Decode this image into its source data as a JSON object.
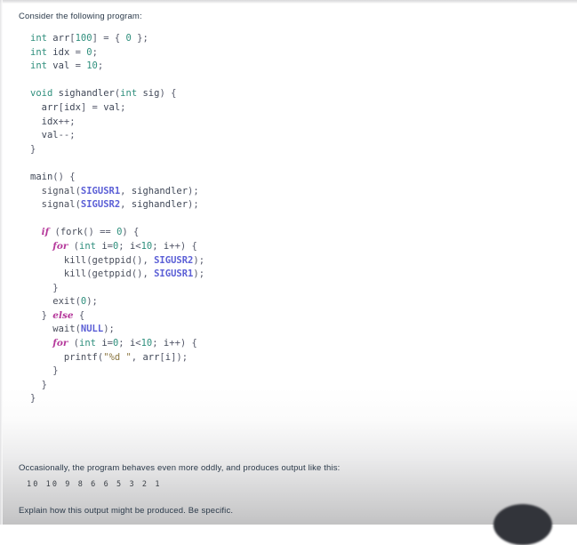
{
  "page": {
    "background_top": "#ffffff",
    "background_bottom": "#c2c2c3"
  },
  "intro": {
    "text": "Consider the following program:"
  },
  "code": {
    "language": "c",
    "lines": [
      [
        {
          "t": "int",
          "c": "tok-type"
        },
        {
          "t": " ",
          "c": "tok-plain"
        },
        {
          "t": "arr",
          "c": "tok-ident"
        },
        {
          "t": "[",
          "c": "tok-punc"
        },
        {
          "t": "100",
          "c": "tok-num"
        },
        {
          "t": "]",
          "c": "tok-punc"
        },
        {
          "t": " = { ",
          "c": "tok-punc"
        },
        {
          "t": "0",
          "c": "tok-num"
        },
        {
          "t": " };",
          "c": "tok-punc"
        }
      ],
      [
        {
          "t": "int",
          "c": "tok-type"
        },
        {
          "t": " ",
          "c": "tok-plain"
        },
        {
          "t": "idx",
          "c": "tok-ident"
        },
        {
          "t": " = ",
          "c": "tok-punc"
        },
        {
          "t": "0",
          "c": "tok-num"
        },
        {
          "t": ";",
          "c": "tok-punc"
        }
      ],
      [
        {
          "t": "int",
          "c": "tok-type"
        },
        {
          "t": " ",
          "c": "tok-plain"
        },
        {
          "t": "val",
          "c": "tok-ident"
        },
        {
          "t": " = ",
          "c": "tok-punc"
        },
        {
          "t": "10",
          "c": "tok-num"
        },
        {
          "t": ";",
          "c": "tok-punc"
        }
      ],
      [],
      [
        {
          "t": "void",
          "c": "tok-type"
        },
        {
          "t": " ",
          "c": "tok-plain"
        },
        {
          "t": "sighandler",
          "c": "tok-ident"
        },
        {
          "t": "(",
          "c": "tok-punc"
        },
        {
          "t": "int",
          "c": "tok-type"
        },
        {
          "t": " ",
          "c": "tok-plain"
        },
        {
          "t": "sig",
          "c": "tok-ident"
        },
        {
          "t": ") {",
          "c": "tok-punc"
        }
      ],
      [
        {
          "t": "  arr",
          "c": "tok-ident"
        },
        {
          "t": "[",
          "c": "tok-punc"
        },
        {
          "t": "idx",
          "c": "tok-ident"
        },
        {
          "t": "] = ",
          "c": "tok-punc"
        },
        {
          "t": "val",
          "c": "tok-ident"
        },
        {
          "t": ";",
          "c": "tok-punc"
        }
      ],
      [
        {
          "t": "  idx",
          "c": "tok-ident"
        },
        {
          "t": "++;",
          "c": "tok-punc"
        }
      ],
      [
        {
          "t": "  val",
          "c": "tok-ident"
        },
        {
          "t": "--;",
          "c": "tok-punc"
        }
      ],
      [
        {
          "t": "}",
          "c": "tok-punc"
        }
      ],
      [],
      [
        {
          "t": "main",
          "c": "tok-ident"
        },
        {
          "t": "() {",
          "c": "tok-punc"
        }
      ],
      [
        {
          "t": "  signal",
          "c": "tok-fn"
        },
        {
          "t": "(",
          "c": "tok-punc"
        },
        {
          "t": "SIGUSR1",
          "c": "tok-const"
        },
        {
          "t": ", ",
          "c": "tok-punc"
        },
        {
          "t": "sighandler",
          "c": "tok-ident"
        },
        {
          "t": ");",
          "c": "tok-punc"
        }
      ],
      [
        {
          "t": "  signal",
          "c": "tok-fn"
        },
        {
          "t": "(",
          "c": "tok-punc"
        },
        {
          "t": "SIGUSR2",
          "c": "tok-const"
        },
        {
          "t": ", ",
          "c": "tok-punc"
        },
        {
          "t": "sighandler",
          "c": "tok-ident"
        },
        {
          "t": ");",
          "c": "tok-punc"
        }
      ],
      [],
      [
        {
          "t": "  ",
          "c": "tok-plain"
        },
        {
          "t": "if",
          "c": "tok-kw"
        },
        {
          "t": " (",
          "c": "tok-punc"
        },
        {
          "t": "fork",
          "c": "tok-fn"
        },
        {
          "t": "() == ",
          "c": "tok-punc"
        },
        {
          "t": "0",
          "c": "tok-num"
        },
        {
          "t": ") {",
          "c": "tok-punc"
        }
      ],
      [
        {
          "t": "    ",
          "c": "tok-plain"
        },
        {
          "t": "for",
          "c": "tok-kw"
        },
        {
          "t": " (",
          "c": "tok-punc"
        },
        {
          "t": "int",
          "c": "tok-type"
        },
        {
          "t": " ",
          "c": "tok-plain"
        },
        {
          "t": "i",
          "c": "tok-ident"
        },
        {
          "t": "=",
          "c": "tok-punc"
        },
        {
          "t": "0",
          "c": "tok-num"
        },
        {
          "t": "; ",
          "c": "tok-punc"
        },
        {
          "t": "i",
          "c": "tok-ident"
        },
        {
          "t": "<",
          "c": "tok-punc"
        },
        {
          "t": "10",
          "c": "tok-num"
        },
        {
          "t": "; ",
          "c": "tok-punc"
        },
        {
          "t": "i",
          "c": "tok-ident"
        },
        {
          "t": "++) {",
          "c": "tok-punc"
        }
      ],
      [
        {
          "t": "      kill",
          "c": "tok-fn"
        },
        {
          "t": "(",
          "c": "tok-punc"
        },
        {
          "t": "getppid",
          "c": "tok-fn"
        },
        {
          "t": "(), ",
          "c": "tok-punc"
        },
        {
          "t": "SIGUSR2",
          "c": "tok-const"
        },
        {
          "t": ");",
          "c": "tok-punc"
        }
      ],
      [
        {
          "t": "      kill",
          "c": "tok-fn"
        },
        {
          "t": "(",
          "c": "tok-punc"
        },
        {
          "t": "getppid",
          "c": "tok-fn"
        },
        {
          "t": "(), ",
          "c": "tok-punc"
        },
        {
          "t": "SIGUSR1",
          "c": "tok-const"
        },
        {
          "t": ");",
          "c": "tok-punc"
        }
      ],
      [
        {
          "t": "    }",
          "c": "tok-punc"
        }
      ],
      [
        {
          "t": "    exit",
          "c": "tok-fn"
        },
        {
          "t": "(",
          "c": "tok-punc"
        },
        {
          "t": "0",
          "c": "tok-num"
        },
        {
          "t": ");",
          "c": "tok-punc"
        }
      ],
      [
        {
          "t": "  } ",
          "c": "tok-punc"
        },
        {
          "t": "else",
          "c": "tok-kw"
        },
        {
          "t": " {",
          "c": "tok-punc"
        }
      ],
      [
        {
          "t": "    wait",
          "c": "tok-fn"
        },
        {
          "t": "(",
          "c": "tok-punc"
        },
        {
          "t": "NULL",
          "c": "tok-const"
        },
        {
          "t": ");",
          "c": "tok-punc"
        }
      ],
      [
        {
          "t": "    ",
          "c": "tok-plain"
        },
        {
          "t": "for",
          "c": "tok-kw"
        },
        {
          "t": " (",
          "c": "tok-punc"
        },
        {
          "t": "int",
          "c": "tok-type"
        },
        {
          "t": " ",
          "c": "tok-plain"
        },
        {
          "t": "i",
          "c": "tok-ident"
        },
        {
          "t": "=",
          "c": "tok-punc"
        },
        {
          "t": "0",
          "c": "tok-num"
        },
        {
          "t": "; ",
          "c": "tok-punc"
        },
        {
          "t": "i",
          "c": "tok-ident"
        },
        {
          "t": "<",
          "c": "tok-punc"
        },
        {
          "t": "10",
          "c": "tok-num"
        },
        {
          "t": "; ",
          "c": "tok-punc"
        },
        {
          "t": "i",
          "c": "tok-ident"
        },
        {
          "t": "++) {",
          "c": "tok-punc"
        }
      ],
      [
        {
          "t": "      printf",
          "c": "tok-fn"
        },
        {
          "t": "(",
          "c": "tok-punc"
        },
        {
          "t": "\"%d \"",
          "c": "tok-str"
        },
        {
          "t": ", ",
          "c": "tok-punc"
        },
        {
          "t": "arr",
          "c": "tok-ident"
        },
        {
          "t": "[",
          "c": "tok-punc"
        },
        {
          "t": "i",
          "c": "tok-ident"
        },
        {
          "t": "]);",
          "c": "tok-punc"
        }
      ],
      [
        {
          "t": "    }",
          "c": "tok-punc"
        }
      ],
      [
        {
          "t": "  }",
          "c": "tok-punc"
        }
      ],
      [
        {
          "t": "}",
          "c": "tok-punc"
        }
      ]
    ]
  },
  "occasionally": {
    "text": "Occasionally, the program behaves even more oddly, and produces output like this:"
  },
  "program_output": {
    "values": [
      10,
      10,
      9,
      8,
      6,
      6,
      5,
      3,
      2,
      1
    ],
    "text": "10 10 9 8 6 6 5 3 2 1"
  },
  "explain": {
    "text": "Explain how this output might be produced. Be specific."
  }
}
